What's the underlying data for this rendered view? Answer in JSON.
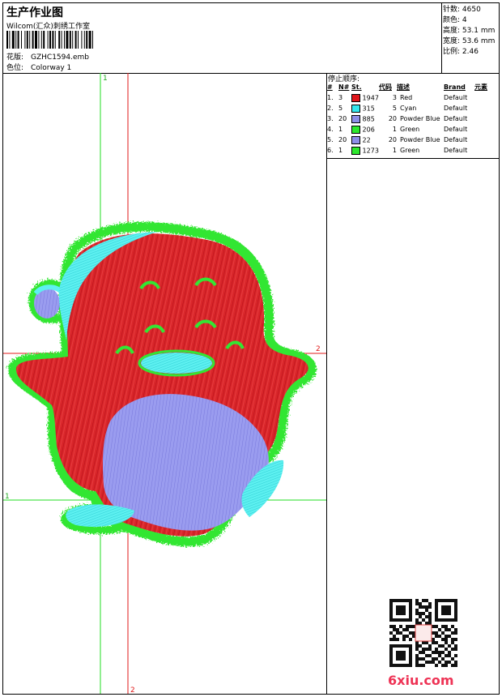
{
  "header": {
    "title": "生产作业图",
    "subtitle": "Wilcom(汇众)刺绣工作室",
    "design_label": "花版:",
    "design_file": "GZHC1594.emb",
    "colorway_label": "色位:",
    "colorway": "Colorway 1"
  },
  "stats": {
    "stitches_label": "针数:",
    "stitches": "4650",
    "colors_label": "颜色:",
    "colors": "4",
    "height_label": "高度:",
    "height": "53.1 mm",
    "width_label": "宽度:",
    "width": "53.6 mm",
    "ratio_label": "比例:",
    "ratio": "2.46"
  },
  "sequence": {
    "title": "停止顺序:",
    "headers": [
      "#",
      "N#",
      "St.",
      "代码",
      "描述",
      "Brand",
      "元素"
    ],
    "rows": [
      {
        "idx": "1.",
        "n": "3",
        "color": "#e0161b",
        "st": "1947",
        "code": "3",
        "desc": "Red",
        "brand": "Default"
      },
      {
        "idx": "2.",
        "n": "5",
        "color": "#35e8ee",
        "st": "315",
        "code": "5",
        "desc": "Cyan",
        "brand": "Default"
      },
      {
        "idx": "3.",
        "n": "20",
        "color": "#8e8ee8",
        "st": "885",
        "code": "20",
        "desc": "Powder Blue",
        "brand": "Default"
      },
      {
        "idx": "4.",
        "n": "1",
        "color": "#2ee82e",
        "st": "206",
        "code": "1",
        "desc": "Green",
        "brand": "Default"
      },
      {
        "idx": "5.",
        "n": "20",
        "color": "#8e8ee8",
        "st": "22",
        "code": "20",
        "desc": "Powder Blue",
        "brand": "Default"
      },
      {
        "idx": "6.",
        "n": "1",
        "color": "#2ee82e",
        "st": "1273",
        "code": "1",
        "desc": "Green",
        "brand": "Default"
      }
    ]
  },
  "guides": {
    "v1": "1",
    "v2": "2",
    "h1": "1",
    "h2": "2"
  },
  "watermark": {
    "text": "6xiu.com"
  }
}
